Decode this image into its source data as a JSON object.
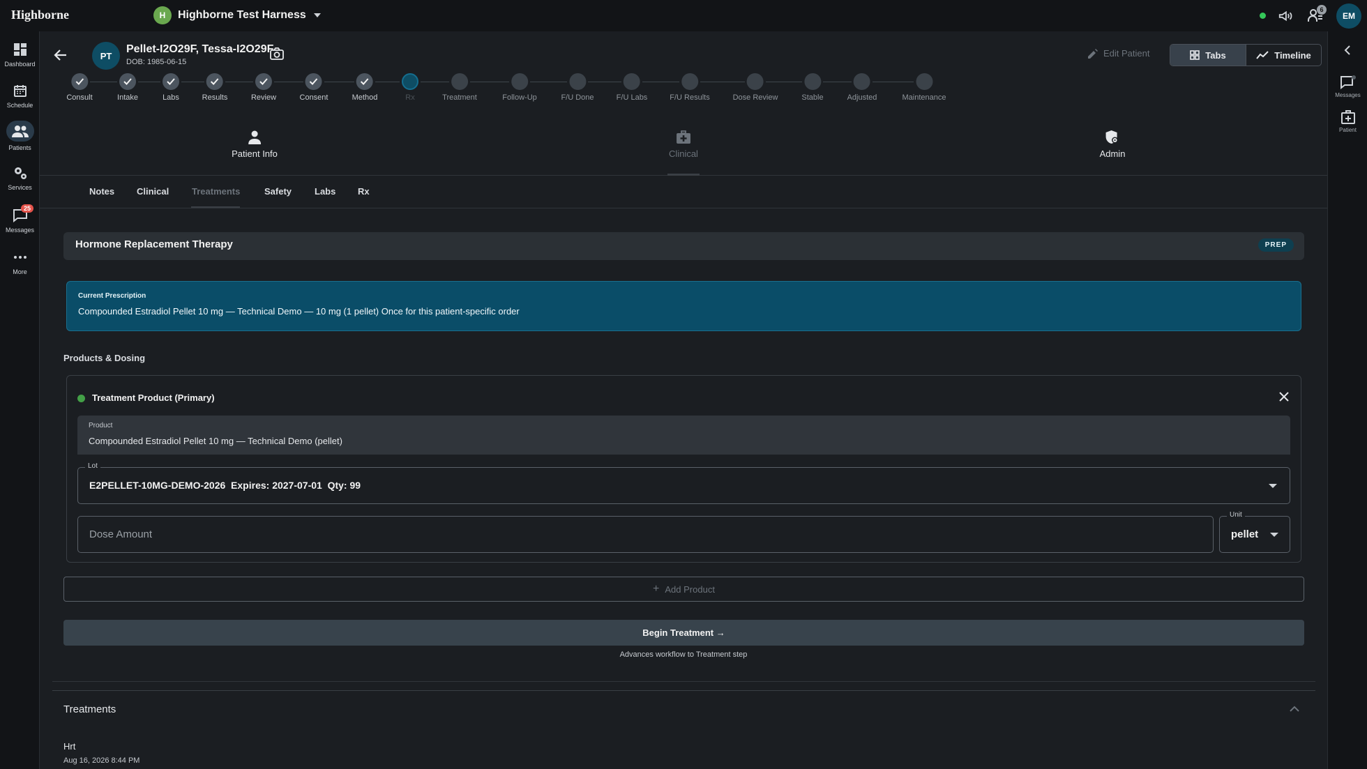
{
  "app": {
    "brand": "Highborne",
    "org_initial": "H",
    "org_name": "Highborne Test Harness",
    "notification_count": "6",
    "user_initials": "EM"
  },
  "leftnav": {
    "items": [
      {
        "label": "Dashboard",
        "icon": "dashboard-icon"
      },
      {
        "label": "Schedule",
        "icon": "calendar-icon"
      },
      {
        "label": "Patients",
        "icon": "people-icon"
      },
      {
        "label": "Services",
        "icon": "gears-icon"
      },
      {
        "label": "Messages",
        "icon": "chat-icon",
        "badge": "25"
      },
      {
        "label": "More",
        "icon": "more-icon"
      }
    ]
  },
  "rightrail": {
    "items": [
      {
        "label": "Messages",
        "icon": "chat-icon"
      },
      {
        "label": "Patient",
        "icon": "medical-folder-icon"
      }
    ]
  },
  "patient": {
    "initials": "PT",
    "name": "Pellet-I2O29F, Tessa-I2O29F",
    "dob": "DOB: 1985-06-15"
  },
  "header": {
    "edit_patient": "Edit Patient",
    "view_tabs": "Tabs",
    "view_timeline": "Timeline"
  },
  "stepper": {
    "steps": [
      {
        "label": "Consult",
        "state": "done"
      },
      {
        "label": "Intake",
        "state": "done"
      },
      {
        "label": "Labs",
        "state": "done"
      },
      {
        "label": "Results",
        "state": "done"
      },
      {
        "label": "Review",
        "state": "done"
      },
      {
        "label": "Consent",
        "state": "done"
      },
      {
        "label": "Method",
        "state": "done"
      },
      {
        "label": "Rx",
        "state": "current"
      },
      {
        "label": "Treatment",
        "state": "future"
      },
      {
        "label": "Follow-Up",
        "state": "future"
      },
      {
        "label": "F/U Done",
        "state": "future"
      },
      {
        "label": "F/U Labs",
        "state": "future"
      },
      {
        "label": "F/U Results",
        "state": "future"
      },
      {
        "label": "Dose Review",
        "state": "future"
      },
      {
        "label": "Stable",
        "state": "future"
      },
      {
        "label": "Adjusted",
        "state": "future"
      },
      {
        "label": "Maintenance",
        "state": "future"
      }
    ]
  },
  "section_tabs": {
    "patient_info": "Patient Info",
    "clinical": "Clinical",
    "admin": "Admin"
  },
  "sub_tabs": {
    "notes": "Notes",
    "clinical": "Clinical",
    "treatments": "Treatments",
    "safety": "Safety",
    "labs": "Labs",
    "rx": "Rx"
  },
  "therapy": {
    "title": "Hormone Replacement Therapy",
    "badge": "PREP"
  },
  "prescription": {
    "label": "Current Prescription",
    "text": "Compounded Estradiol Pellet 10 mg — Technical Demo — 10 mg (1 pellet) Once for this patient-specific order"
  },
  "products": {
    "heading": "Products & Dosing",
    "card_title": "Treatment Product (Primary)",
    "product_label": "Product",
    "product_value": "Compounded Estradiol Pellet 10 mg — Technical Demo (pellet)",
    "lot_label": "Lot",
    "lot_value": "E2PELLET-10MG-DEMO-2026  Expires: 2027-07-01  Qty: 99",
    "dose_placeholder": "Dose Amount",
    "unit_label": "Unit",
    "unit_value": "pellet",
    "add_product": "Add Product"
  },
  "actions": {
    "begin_treatment": "Begin Treatment →",
    "advances_note": "Advances workflow to Treatment step"
  },
  "treatments": {
    "heading": "Treatments",
    "items": [
      {
        "name": "Hrt",
        "date": "Aug 16, 2026 8:44 PM"
      }
    ]
  }
}
